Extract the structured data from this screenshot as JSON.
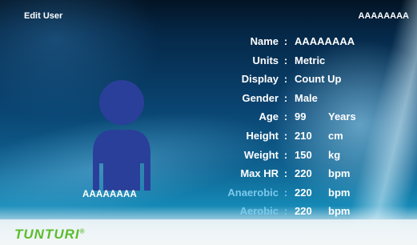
{
  "header": {
    "title": "Edit User",
    "user_name": "AAAAAAAA"
  },
  "avatar": {
    "name": "AAAAAAAA",
    "color": "#2a3f99"
  },
  "fields": [
    {
      "label": "Name",
      "value": "AAAAAAAA",
      "unit": "",
      "dim": false
    },
    {
      "label": "Units",
      "value": "Metric",
      "unit": "",
      "dim": false
    },
    {
      "label": "Display",
      "value": "Count Up",
      "unit": "",
      "dim": false
    },
    {
      "label": "Gender",
      "value": "Male",
      "unit": "",
      "dim": false
    },
    {
      "label": "Age",
      "value": "99",
      "unit": "Years",
      "dim": false
    },
    {
      "label": "Height",
      "value": "210",
      "unit": "cm",
      "dim": false
    },
    {
      "label": "Weight",
      "value": "150",
      "unit": "kg",
      "dim": false
    },
    {
      "label": "Max HR",
      "value": "220",
      "unit": "bpm",
      "dim": false
    },
    {
      "label": "Anaerobic",
      "value": "220",
      "unit": "bpm",
      "dim": true
    },
    {
      "label": "Aerobic",
      "value": "220",
      "unit": "bpm",
      "dim": true
    }
  ],
  "logo": {
    "text": "TUNTURI",
    "mark": "®",
    "color": "#5cbd2c"
  }
}
